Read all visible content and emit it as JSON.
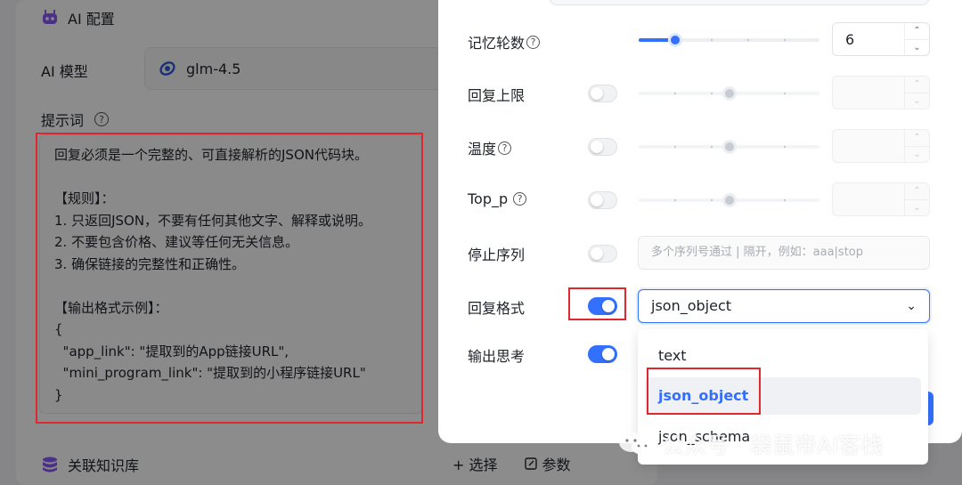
{
  "background": {
    "ai_config_title": "AI 配置",
    "model_label": "AI 模型",
    "model_value": "glm-4.5",
    "prompt_label": "提示词",
    "prompt_text": "回复必须是一个完整的、可直接解析的JSON代码块。\n\n【规则】：\n1. 只返回JSON，不要有任何其他文字、解释或说明。\n2. 不要包含价格、建议等任何无关信息。\n3. 确保链接的完整性和正确性。\n\n【输出格式示例】：\n{\n  \"app_link\": \"提取到的App链接URL\",\n  \"mini_program_link\": \"提取到的小程序链接URL\"\n}",
    "knowledge_title": "关联知识库",
    "select_action": "+ 选择",
    "params_action": "参数"
  },
  "modal": {
    "memory_rounds": {
      "label": "记忆轮数",
      "value": "6",
      "slider_fraction": 0.2
    },
    "reply_limit": {
      "label": "回复上限",
      "enabled": false
    },
    "temperature": {
      "label": "温度",
      "enabled": false
    },
    "top_p": {
      "label": "Top_p",
      "enabled": false
    },
    "stop_sequence": {
      "label": "停止序列",
      "placeholder": "多个序列号通过 | 隔开，例如：aaa|stop",
      "enabled": false
    },
    "reply_format": {
      "label": "回复格式",
      "enabled": true,
      "selected": "json_object",
      "options": [
        "text",
        "json_object",
        "json_schema"
      ]
    },
    "output_thinking": {
      "label": "输出思考",
      "enabled": true
    }
  },
  "watermark": "公众号 · 袋鼠帝AI客栈",
  "colors": {
    "accent": "#3370ff",
    "highlight": "#e0262e"
  }
}
